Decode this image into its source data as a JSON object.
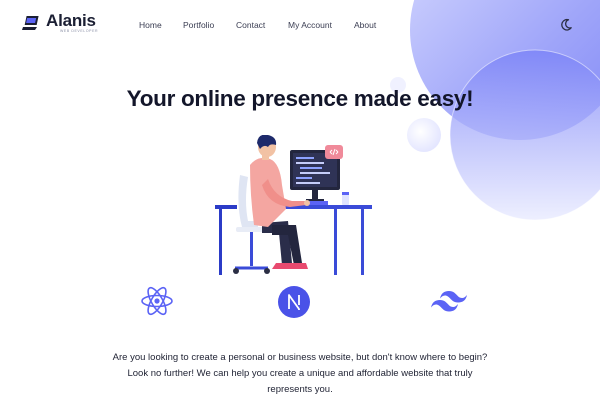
{
  "brand": {
    "name": "Alanis",
    "tagline": "web developer"
  },
  "nav": {
    "items": [
      {
        "label": "Home"
      },
      {
        "label": "Portfolio"
      },
      {
        "label": "Contact"
      },
      {
        "label": "My Account"
      },
      {
        "label": "About"
      }
    ]
  },
  "header": {
    "theme_toggle_icon": "moon-icon"
  },
  "hero": {
    "title": "Your online presence made easy!",
    "illustration": "developer-at-desk-illustration",
    "description": "Are you looking to create a personal or business website, but don't know where to begin? Look no further! We can help you create a unique and affordable website that truly represents you."
  },
  "tech_icons": [
    "react-icon",
    "nextjs-icon",
    "tailwind-icon"
  ],
  "colors": {
    "accent": "#5b63f5",
    "accent_light": "#c9cdff",
    "text_dark": "#13162a",
    "shirt": "#f4a6a1",
    "pants": "#2a2d4a",
    "shoes": "#e84a6f"
  }
}
